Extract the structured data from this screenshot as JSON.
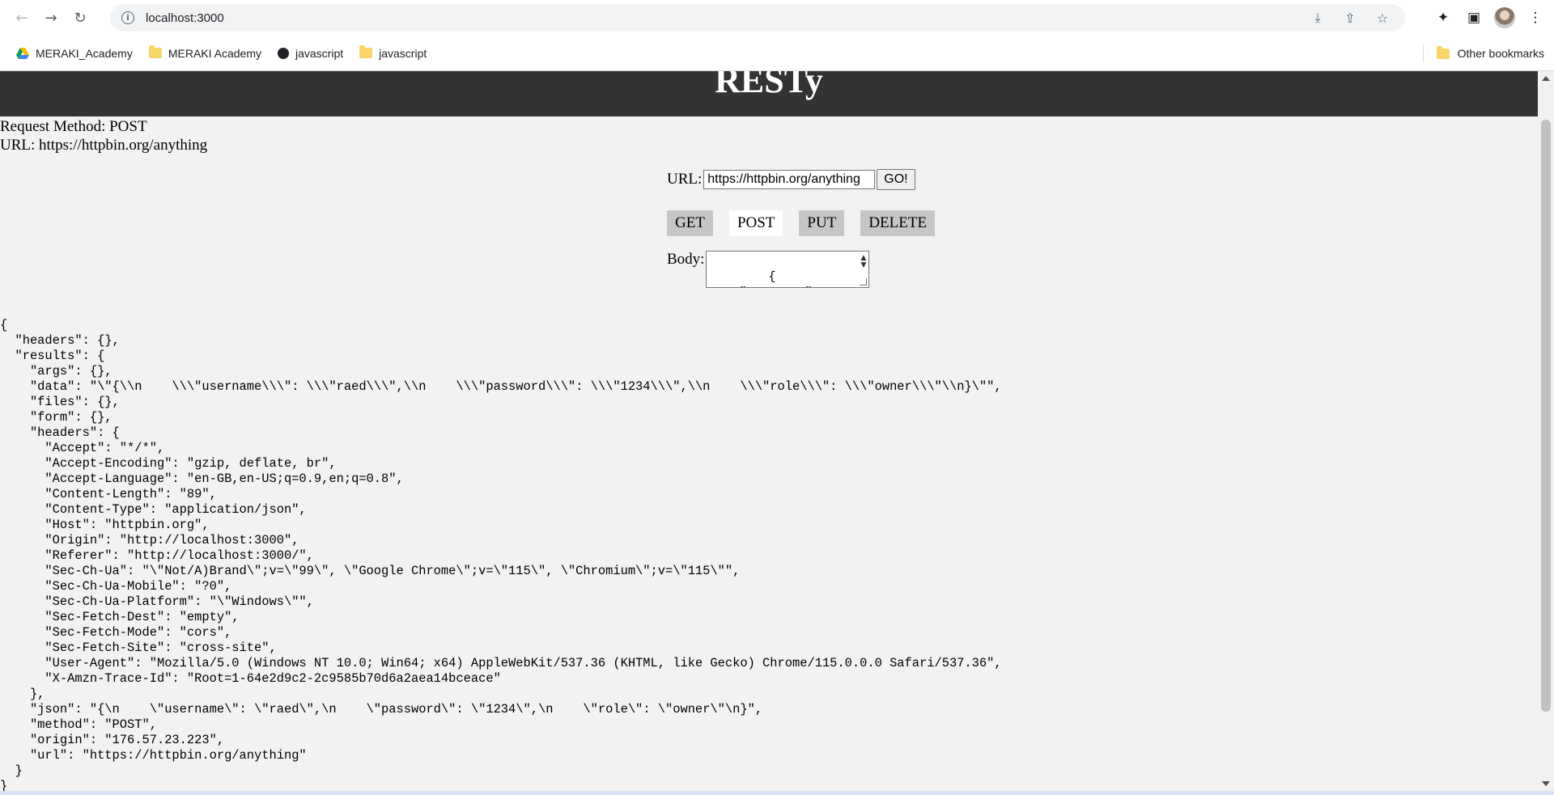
{
  "browser": {
    "url": "localhost:3000",
    "bookmarks": [
      {
        "label": "MERAKI_Academy",
        "icon": "google-drive-icon"
      },
      {
        "label": "MERAKI Academy",
        "icon": "folder-icon"
      },
      {
        "label": "javascript",
        "icon": "globe-icon"
      },
      {
        "label": "javascript",
        "icon": "folder-icon"
      }
    ],
    "other_bookmarks": "Other bookmarks"
  },
  "app": {
    "title": "RESTy",
    "request_method_line": "Request Method: POST",
    "url_line": "URL: https://httpbin.org/anything",
    "url_label": "URL:",
    "url_value": "https://httpbin.org/anything",
    "go_label": "GO!",
    "methods": [
      "GET",
      "POST",
      "PUT",
      "DELETE"
    ],
    "active_method": "POST",
    "body_label": "Body:",
    "body_value": "{\n    \"username\":"
  },
  "response_lines": [
    "{",
    "  \"headers\": {},",
    "  \"results\": {",
    "    \"args\": {},",
    "    \"data\": \"\\\"{\\\\n    \\\\\\\"username\\\\\\\": \\\\\\\"raed\\\\\\\",\\\\n    \\\\\\\"password\\\\\\\": \\\\\\\"1234\\\\\\\",\\\\n    \\\\\\\"role\\\\\\\": \\\\\\\"owner\\\\\\\"\\\\n}\\\"\",",
    "    \"files\": {},",
    "    \"form\": {},",
    "    \"headers\": {",
    "      \"Accept\": \"*/*\",",
    "      \"Accept-Encoding\": \"gzip, deflate, br\",",
    "      \"Accept-Language\": \"en-GB,en-US;q=0.9,en;q=0.8\",",
    "      \"Content-Length\": \"89\",",
    "      \"Content-Type\": \"application/json\",",
    "      \"Host\": \"httpbin.org\",",
    "      \"Origin\": \"http://localhost:3000\",",
    "      \"Referer\": \"http://localhost:3000/\",",
    "      \"Sec-Ch-Ua\": \"\\\"Not/A)Brand\\\";v=\\\"99\\\", \\\"Google Chrome\\\";v=\\\"115\\\", \\\"Chromium\\\";v=\\\"115\\\"\",",
    "      \"Sec-Ch-Ua-Mobile\": \"?0\",",
    "      \"Sec-Ch-Ua-Platform\": \"\\\"Windows\\\"\",",
    "      \"Sec-Fetch-Dest\": \"empty\",",
    "      \"Sec-Fetch-Mode\": \"cors\",",
    "      \"Sec-Fetch-Site\": \"cross-site\",",
    "      \"User-Agent\": \"Mozilla/5.0 (Windows NT 10.0; Win64; x64) AppleWebKit/537.36 (KHTML, like Gecko) Chrome/115.0.0.0 Safari/537.36\",",
    "      \"X-Amzn-Trace-Id\": \"Root=1-64e2d9c2-2c9585b70d6a2aea14bceace\"",
    "    },",
    "    \"json\": \"{\\n    \\\"username\\\": \\\"raed\\\",\\n    \\\"password\\\": \\\"1234\\\",\\n    \\\"role\\\": \\\"owner\\\"\\n}\",",
    "    \"method\": \"POST\",",
    "    \"origin\": \"176.57.23.223\",",
    "    \"url\": \"https://httpbin.org/anything\"",
    "  }",
    "}"
  ]
}
